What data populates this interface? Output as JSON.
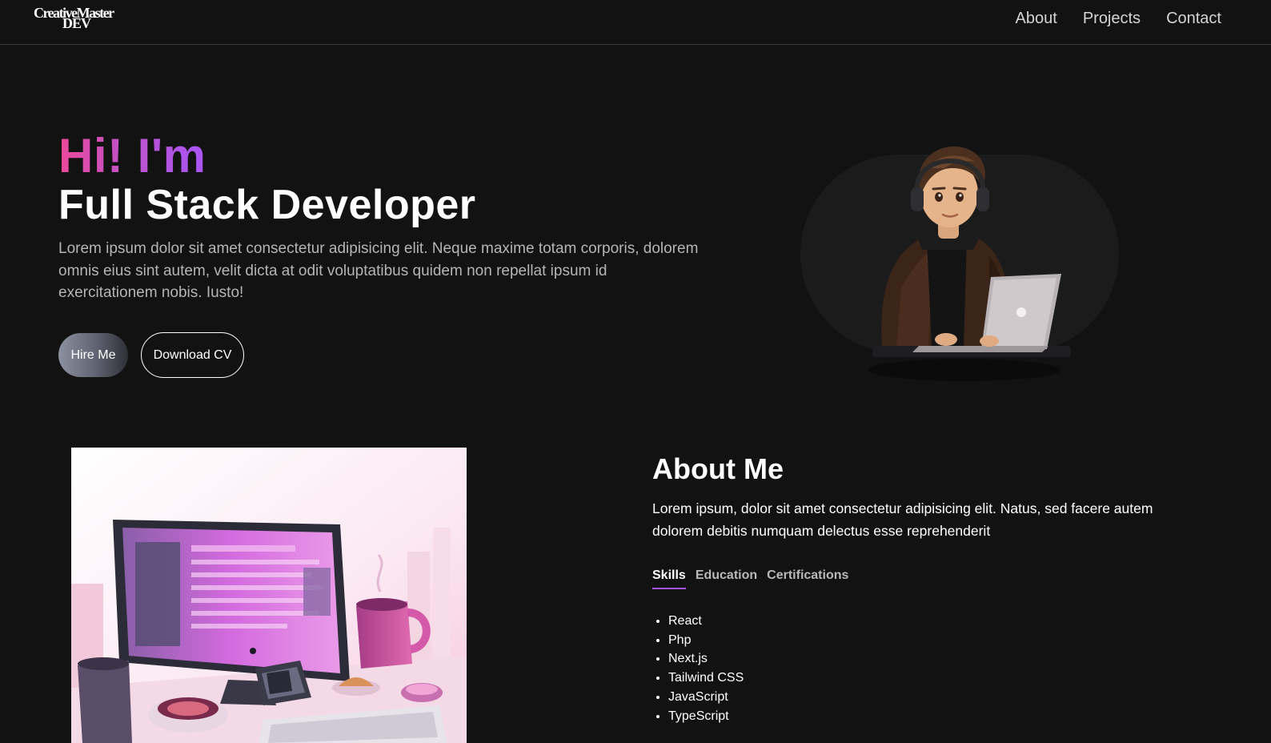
{
  "nav": {
    "logo_line1": "CreativeMaster",
    "logo_line2": "DEV",
    "links": [
      "About",
      "Projects",
      "Contact"
    ]
  },
  "hero": {
    "greeting": "Hi! I'm",
    "role": "Full Stack Developer",
    "description": "Lorem ipsum dolor sit amet consectetur adipisicing elit. Neque maxime totam corporis, dolorem omnis eius sint autem, velit dicta at odit voluptatibus quidem non repellat ipsum id exercitationem nobis. Iusto!",
    "hire_button": "Hire Me",
    "cv_button": "Download CV",
    "avatar_icon": "developer-avatar-icon"
  },
  "about": {
    "title": "About Me",
    "description": "Lorem ipsum, dolor sit amet consectetur adipisicing elit. Natus, sed facere autem dolorem debitis numquam delectus esse reprehenderit",
    "tabs": [
      "Skills",
      "Education",
      "Certifications"
    ],
    "active_tab": "Skills",
    "skills": [
      "React",
      "Php",
      "Next.js",
      "Tailwind CSS",
      "JavaScript",
      "TypeScript"
    ],
    "illustration_icon": "workspace-illustration"
  },
  "colors": {
    "background": "#121212",
    "accent_pink": "#ec4899",
    "accent_purple": "#a855f7"
  }
}
